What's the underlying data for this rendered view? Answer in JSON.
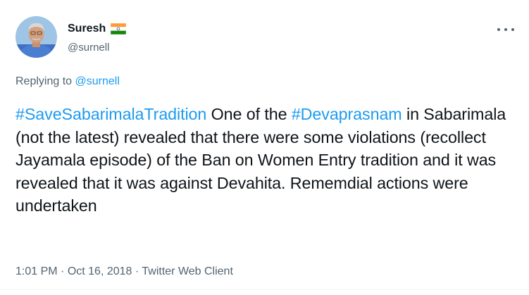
{
  "tweet": {
    "author": {
      "display_name": "Suresh",
      "flag_icon": "india-flag-icon",
      "handle": "@surnell"
    },
    "reply": {
      "prefix": "Replying to ",
      "mention": "@surnell"
    },
    "text": {
      "hashtag1": "#SaveSabarimalaTradition",
      "part1": " One of the ",
      "hashtag2": "#Devaprasnam",
      "part2": " in Sabarimala (not the latest) revealed that there were some violations (recollect Jayamala episode) of the Ban on Women Entry tradition and it was revealed that it was against Devahita. Rememdial actions were undertaken"
    },
    "meta": {
      "time": "1:01 PM",
      "separator1": " · ",
      "date": "Oct 16, 2018",
      "separator2": " · ",
      "source": "Twitter Web Client"
    },
    "more_icon": "more-horizontal-icon"
  },
  "colors": {
    "accent": "#1d9bf0",
    "secondary_text": "#536471",
    "primary_text": "#0f1419"
  }
}
